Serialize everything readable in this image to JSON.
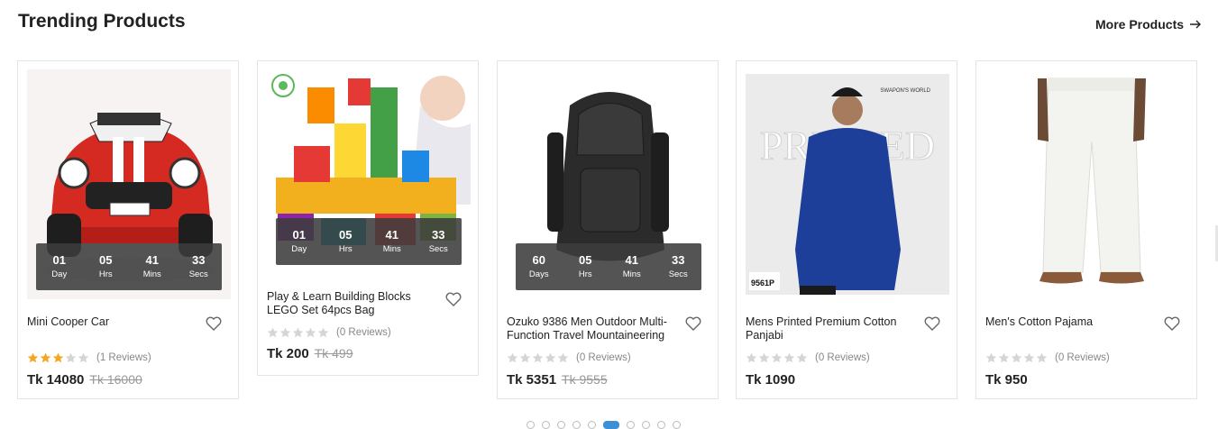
{
  "section": {
    "title": "Trending Products",
    "more_label": "More Products"
  },
  "timer_labels": {
    "day": "Day",
    "days": "Days",
    "hrs": "Hrs",
    "mins": "Mins",
    "secs": "Secs"
  },
  "products": [
    {
      "name": "Mini Cooper Car",
      "timer": {
        "d": "01",
        "d_label": "Day",
        "h": "05",
        "m": "41",
        "s": "33"
      },
      "stars": 3,
      "reviews": "(1 Reviews)",
      "price": "Tk 14080",
      "old_price": "Tk 16000",
      "image": "red-toy-car"
    },
    {
      "name": "Play & Learn Building Blocks LEGO Set 64pcs Bag",
      "timer": {
        "d": "01",
        "d_label": "Day",
        "h": "05",
        "m": "41",
        "s": "33"
      },
      "stars": 0,
      "reviews": "(0 Reviews)",
      "price": "Tk 200",
      "old_price": "Tk 499",
      "image": "building-blocks-child"
    },
    {
      "name": "Ozuko 9386 Men Outdoor Multi-Function Travel Mountaineering",
      "timer": {
        "d": "60",
        "d_label": "Days",
        "h": "05",
        "m": "41",
        "s": "33"
      },
      "stars": 0,
      "reviews": "(0 Reviews)",
      "price": "Tk 5351",
      "old_price": "Tk 9555",
      "image": "black-backpack"
    },
    {
      "name": "Mens Printed Premium Cotton Panjabi",
      "stars": 0,
      "reviews": "(0 Reviews)",
      "price": "Tk 1090",
      "old_price": "",
      "image": "blue-panjabi-man"
    },
    {
      "name": "Men's Cotton Pajama",
      "stars": 0,
      "reviews": "(0 Reviews)",
      "price": "Tk 950",
      "old_price": "",
      "image": "white-pajama"
    }
  ],
  "image_text": {
    "panjabi_banner": "PRINTED",
    "panjabi_brand": "SWAPON'S WORLD",
    "panjabi_code": "9561P"
  },
  "carousel": {
    "pages": 10,
    "active_index": 5
  },
  "colors": {
    "star_filled": "#f5a623",
    "star_empty": "#d5d5d5",
    "dot_active": "#3d8fd6",
    "car_red": "#d42a22",
    "panjabi_blue": "#1d3f9a"
  }
}
